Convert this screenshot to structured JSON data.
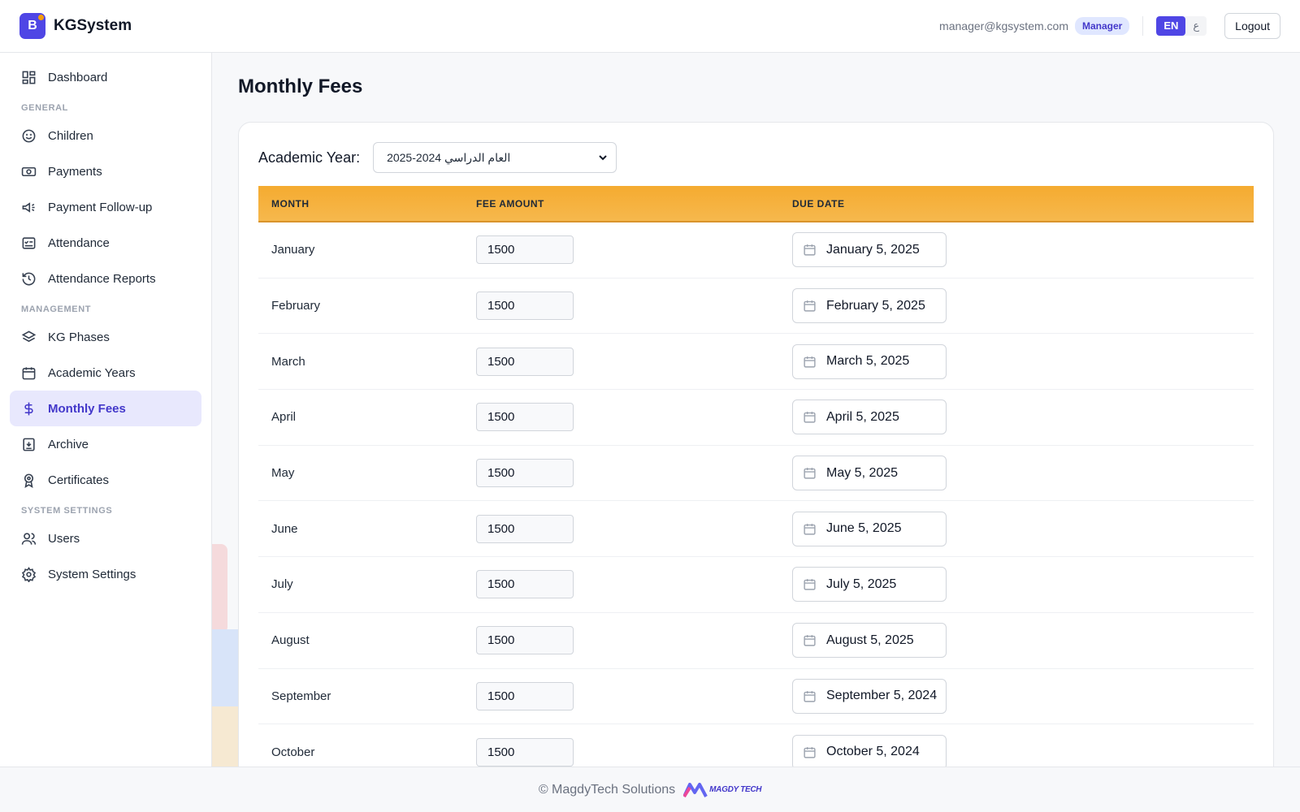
{
  "app": {
    "name": "KGSystem",
    "logo_letter": "B",
    "accent_color": "#4f46e5"
  },
  "header": {
    "user_email": "manager@kgsystem.com",
    "role_badge": "Manager",
    "lang_en": "EN",
    "lang_ar": "ع",
    "logout_label": "Logout"
  },
  "sidebar": {
    "dashboard": {
      "label": "Dashboard",
      "icon": "dashboard-icon"
    },
    "section_general": "GENERAL",
    "general_items": [
      {
        "label": "Children",
        "icon": "smile-icon"
      },
      {
        "label": "Payments",
        "icon": "cash-icon"
      },
      {
        "label": "Payment Follow-up",
        "icon": "megaphone-icon"
      },
      {
        "label": "Attendance",
        "icon": "checklist-icon"
      },
      {
        "label": "Attendance Reports",
        "icon": "history-icon"
      }
    ],
    "section_management": "MANAGEMENT",
    "management_items": [
      {
        "label": "KG Phases",
        "icon": "layers-icon"
      },
      {
        "label": "Academic Years",
        "icon": "calendar-icon"
      },
      {
        "label": "Monthly Fees",
        "icon": "dollar-icon",
        "active": true
      },
      {
        "label": "Archive",
        "icon": "archive-icon"
      },
      {
        "label": "Certificates",
        "icon": "award-icon"
      }
    ],
    "section_system": "SYSTEM SETTINGS",
    "system_items": [
      {
        "label": "Users",
        "icon": "users-icon"
      },
      {
        "label": "System Settings",
        "icon": "gear-icon"
      }
    ]
  },
  "main": {
    "title": "Monthly Fees",
    "academic_year_label": "Academic Year:",
    "academic_year_value": "العام الدراسي 2024-2025",
    "table": {
      "header_color": "#f5ab30",
      "columns": [
        "MONTH",
        "FEE AMOUNT",
        "DUE DATE"
      ],
      "rows": [
        {
          "month": "January",
          "amount": "1500",
          "due": "January 5, 2025"
        },
        {
          "month": "February",
          "amount": "1500",
          "due": "February 5, 2025"
        },
        {
          "month": "March",
          "amount": "1500",
          "due": "March 5, 2025"
        },
        {
          "month": "April",
          "amount": "1500",
          "due": "April 5, 2025"
        },
        {
          "month": "May",
          "amount": "1500",
          "due": "May 5, 2025"
        },
        {
          "month": "June",
          "amount": "1500",
          "due": "June 5, 2025"
        },
        {
          "month": "July",
          "amount": "1500",
          "due": "July 5, 2025"
        },
        {
          "month": "August",
          "amount": "1500",
          "due": "August 5, 2025"
        },
        {
          "month": "September",
          "amount": "1500",
          "due": "September 5, 2024"
        },
        {
          "month": "October",
          "amount": "1500",
          "due": "October 5, 2024"
        }
      ]
    }
  },
  "footer": {
    "copyright": "© MagdyTech Solutions",
    "logo_text": "MAGDY TECH"
  }
}
